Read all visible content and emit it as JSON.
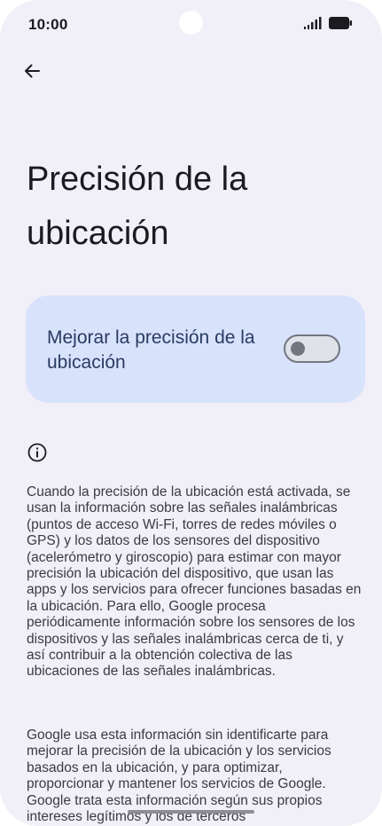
{
  "status_bar": {
    "time": "10:00"
  },
  "app_bar": {
    "back_icon": "arrow-back-icon"
  },
  "page": {
    "title": "Precisión de la ubicación"
  },
  "toggle_card": {
    "label": "Mejorar la precisión de la ubicación",
    "enabled": false
  },
  "info": {
    "icon": "info-icon",
    "paragraph_1": "Cuando la precisión de la ubicación está acti­vada, se usan la información sobre las señales inalámbricas (puntos de acceso Wi‑Fi, torres de redes móviles o GPS) y los datos de los sensores del dispositivo (acelerómetro y giroscopio) para estimar con mayor precisión la ubicación del dispositivo, que usan las apps y los servicios para ofrecer funciones basadas en la ubicación. Para ello, Google procesa periódicamente infor­mación sobre los sensores de los dispositivos y las señales inalámbricas cerca de ti, y así contri­buir a la obtención colectiva de las ubicaciones de las señales inalámbricas.",
    "paragraph_2": "Google usa esta información sin identificarte para mejorar la precisión de la ubicación y los servicios basados en la ubicación, y para optimizar, proporcionar y mantener los servicios de Google. Google trata esta información según sus propios intereses legítimos y los de terceros"
  },
  "colors": {
    "background": "#f1eff7",
    "card": "#d8e2fb",
    "card_text": "#2a3a63",
    "switch_outline": "#72777f"
  }
}
